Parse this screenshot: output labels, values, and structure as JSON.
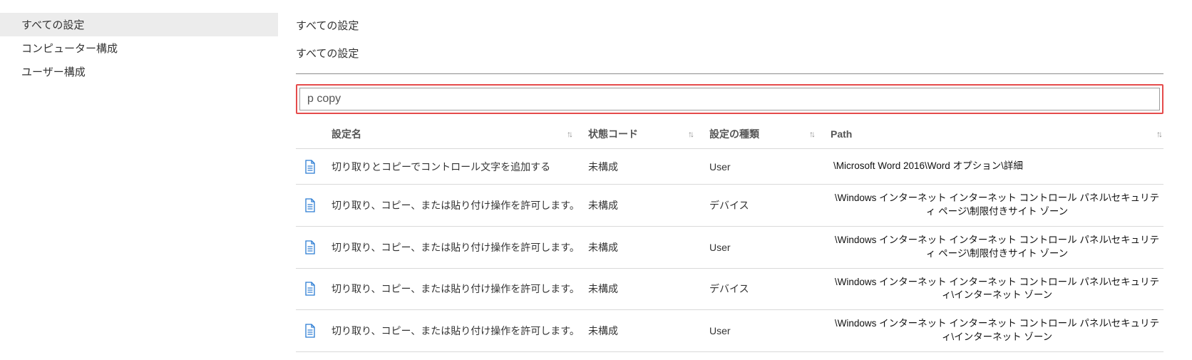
{
  "sidebar": {
    "items": [
      {
        "label": "すべての設定",
        "selected": true
      },
      {
        "label": "コンピューター構成",
        "selected": false
      },
      {
        "label": "ユーザー構成",
        "selected": false
      }
    ]
  },
  "main": {
    "title": "すべての設定",
    "subtitle": "すべての設定",
    "search_value": "p copy"
  },
  "columns": {
    "name": "設定名",
    "status": "状態コード",
    "type": "設定の種類",
    "path": "Path",
    "sort_glyph": "↑↓"
  },
  "rows": [
    {
      "name": "切り取りとコピーでコントロール文字を追加する",
      "status": "未構成",
      "type": "User",
      "path": "\\Microsoft Word 2016\\Word オプション\\詳細",
      "path_align": "left"
    },
    {
      "name": "切り取り、コピー、または貼り付け操作を許可します。",
      "status": "未構成",
      "type": "デバイス",
      "path": "\\Windows インターネット インターネット コントロール パネル\\セキュリティ ページ\\制限付きサイト ゾーン",
      "path_align": "center"
    },
    {
      "name": "切り取り、コピー、または貼り付け操作を許可します。",
      "status": "未構成",
      "type": "User",
      "path": "\\Windows インターネット インターネット コントロール パネル\\セキュリティ ページ\\制限付きサイト ゾーン",
      "path_align": "center"
    },
    {
      "name": "切り取り、コピー、または貼り付け操作を許可します。",
      "status": "未構成",
      "type": "デバイス",
      "path": "\\Windows インターネット インターネット コントロール パネル\\セキュリティ\\インターネット ゾーン",
      "path_align": "center"
    },
    {
      "name": "切り取り、コピー、または貼り付け操作を許可します。",
      "status": "未構成",
      "type": "User",
      "path": "\\Windows インターネット インターネット コントロール パネル\\セキュリティ\\インターネット ゾーン",
      "path_align": "center"
    }
  ]
}
